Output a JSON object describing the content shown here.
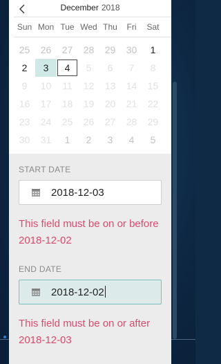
{
  "calendar": {
    "month": "December",
    "year": "2018",
    "weekdays": [
      "Sun",
      "Mon",
      "Tue",
      "Wed",
      "Thu",
      "Fri",
      "Sat"
    ],
    "weeks": [
      [
        {
          "d": "25",
          "s": "muted"
        },
        {
          "d": "26",
          "s": "muted"
        },
        {
          "d": "27",
          "s": "muted"
        },
        {
          "d": "28",
          "s": "muted"
        },
        {
          "d": "29",
          "s": "muted"
        },
        {
          "d": "30",
          "s": "muted"
        },
        {
          "d": "1",
          "s": "active"
        }
      ],
      [
        {
          "d": "2",
          "s": "active"
        },
        {
          "d": "3",
          "s": "selected"
        },
        {
          "d": "4",
          "s": "today"
        },
        {
          "d": "5",
          "s": "faint"
        },
        {
          "d": "6",
          "s": "faint"
        },
        {
          "d": "7",
          "s": "faint"
        },
        {
          "d": "8",
          "s": "faint"
        }
      ],
      [
        {
          "d": "9",
          "s": "faint"
        },
        {
          "d": "10",
          "s": "faint"
        },
        {
          "d": "11",
          "s": "faint"
        },
        {
          "d": "12",
          "s": "faint"
        },
        {
          "d": "13",
          "s": "faint"
        },
        {
          "d": "14",
          "s": "faint"
        },
        {
          "d": "15",
          "s": "faint"
        }
      ],
      [
        {
          "d": "16",
          "s": "faint"
        },
        {
          "d": "17",
          "s": "faint"
        },
        {
          "d": "18",
          "s": "faint"
        },
        {
          "d": "19",
          "s": "faint"
        },
        {
          "d": "20",
          "s": "faint"
        },
        {
          "d": "21",
          "s": "faint"
        },
        {
          "d": "22",
          "s": "faint"
        }
      ],
      [
        {
          "d": "23",
          "s": "faint"
        },
        {
          "d": "24",
          "s": "faint"
        },
        {
          "d": "25",
          "s": "faint"
        },
        {
          "d": "26",
          "s": "faint"
        },
        {
          "d": "27",
          "s": "faint"
        },
        {
          "d": "28",
          "s": "faint"
        },
        {
          "d": "29",
          "s": "faint"
        }
      ],
      [
        {
          "d": "30",
          "s": "faint"
        },
        {
          "d": "31",
          "s": "faint"
        },
        {
          "d": "1",
          "s": "muted"
        },
        {
          "d": "2",
          "s": "muted"
        },
        {
          "d": "3",
          "s": "muted"
        },
        {
          "d": "4",
          "s": "muted"
        },
        {
          "d": "5",
          "s": "muted"
        }
      ]
    ]
  },
  "start": {
    "label": "START DATE",
    "value": "2018-12-03",
    "error": "This field must be on or before 2018-12-02"
  },
  "end": {
    "label": "END DATE",
    "value": "2018-12-02",
    "error": "This field must be on or after 2018-12-03"
  },
  "icons": {
    "prev": "chevron-left-icon",
    "calendar": "calendar-icon"
  },
  "colors": {
    "selected_day_bg": "#cfe9e6",
    "error_text": "#d94a6f",
    "focused_input_bg": "#dcebea",
    "focused_input_border": "#7dbfbf"
  }
}
